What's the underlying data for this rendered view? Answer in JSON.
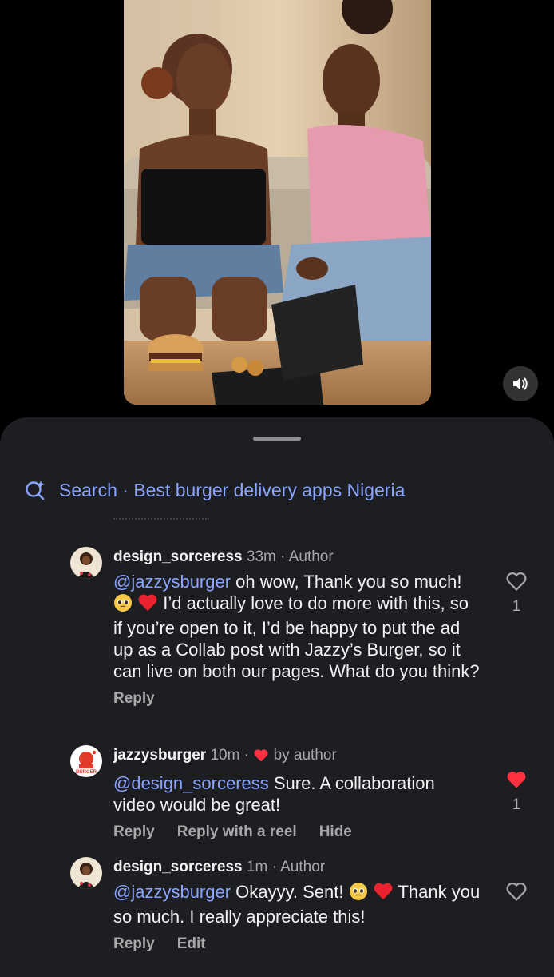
{
  "search": {
    "label": "Search · Best burger delivery apps Nigeria"
  },
  "comments": [
    {
      "username": "design_sorceress",
      "time": "33m",
      "tag": "· Author",
      "mention": "@jazzysburger",
      "text_a": " oh wow, Thank you so much! ",
      "text_b": " I’d actually love to do more with this, so if you’re open to it, I’d be happy to put the ad up as a Collab post with Jazzy’s Burger, so it can live on both our pages. What do you think?",
      "actions": [
        "Reply"
      ],
      "likes": "1",
      "liked": false
    },
    {
      "username": "jazzysburger",
      "time": "10m ·",
      "tag": "by author",
      "mention": "@design_sorceress",
      "text_a": " Sure. A collaboration video would be great!",
      "text_b": "",
      "actions": [
        "Reply",
        "Reply with a reel",
        "Hide"
      ],
      "likes": "1",
      "liked": true
    },
    {
      "username": "design_sorceress",
      "time": "1m",
      "tag": "· Author",
      "mention": "@jazzysburger",
      "text_a": " Okayyy. Sent! ",
      "text_b": " Thank you so much. I really appreciate this!",
      "actions": [
        "Reply",
        "Edit"
      ],
      "likes": "",
      "liked": false
    }
  ],
  "colors": {
    "sheet_bg": "#1c1e22",
    "link_blue": "#8ba4ff",
    "like_red": "#ff3040",
    "muted": "#a8a8a8"
  },
  "icons": [
    "search-sparkle-icon",
    "sound-on-icon",
    "heart-outline-icon",
    "heart-filled-icon",
    "pleading-face-emoji",
    "red-heart-emoji"
  ]
}
